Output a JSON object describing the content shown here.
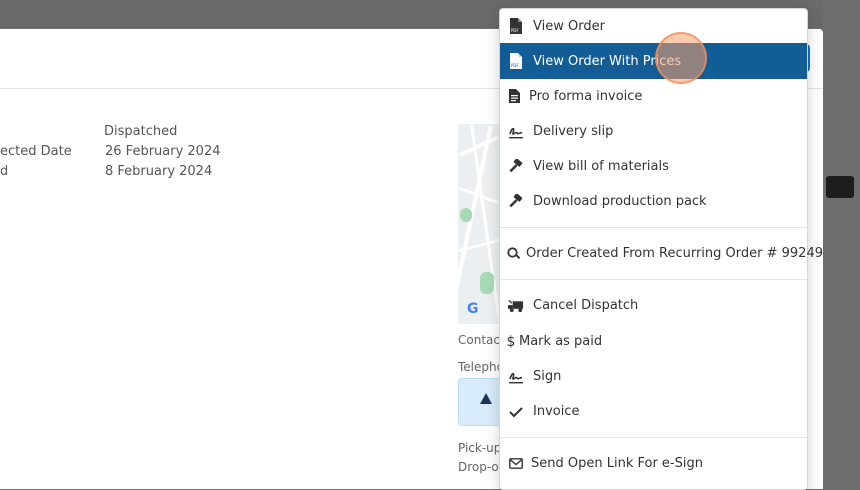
{
  "details": {
    "status_value": "Dispatched",
    "expected_date_label": "ected Date",
    "expected_date_value": "26 February 2024",
    "other_label": "d",
    "other_value": "8 February 2024"
  },
  "side": {
    "contact_label": "Contac",
    "telephone_label": "Telepho",
    "pickup_label": "Pick-up",
    "dropoff_label": "Drop-o"
  },
  "menu": {
    "items": [
      {
        "label": "View Order",
        "icon": "pdf-file-icon"
      },
      {
        "label": "View Order With Prices",
        "icon": "pdf-file-icon",
        "active": true
      },
      {
        "label": "Pro forma invoice",
        "icon": "file-text-icon"
      },
      {
        "label": "Delivery slip",
        "icon": "signature-icon"
      },
      {
        "label": "View bill of materials",
        "icon": "hammer-icon"
      },
      {
        "label": "Download production pack",
        "icon": "hammer-icon"
      },
      {
        "label": "Order Created From Recurring Order # 99249",
        "icon": "search-icon"
      },
      {
        "label": "Cancel Dispatch",
        "icon": "truck-icon"
      },
      {
        "label": "Mark as paid",
        "icon": "dollar-icon"
      },
      {
        "label": "Sign",
        "icon": "signature-icon"
      },
      {
        "label": "Invoice",
        "icon": "check-icon"
      },
      {
        "label": "Send Open Link For e-Sign",
        "icon": "envelope-icon"
      }
    ]
  },
  "colors": {
    "active_bg": "#135d96",
    "menu_text": "#333333",
    "overlay": "#707070"
  }
}
